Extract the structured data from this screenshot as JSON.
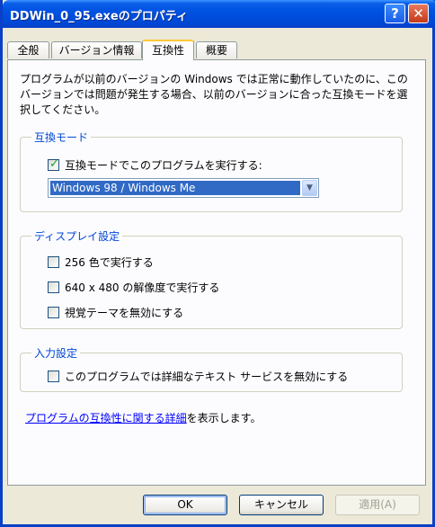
{
  "window": {
    "title": "DDWin_0_95.exeのプロパティ",
    "help_label": "?",
    "close_label": "✕"
  },
  "tabs": [
    {
      "label": "全般",
      "active": false
    },
    {
      "label": "バージョン情報",
      "active": false
    },
    {
      "label": "互換性",
      "active": true
    },
    {
      "label": "概要",
      "active": false
    }
  ],
  "description": "プログラムが以前のバージョンの Windows では正常に動作していたのに、このバージョンでは問題が発生する場合、以前のバージョンに合った互換モードを選択してください。",
  "compat_mode": {
    "legend": "互換モード",
    "checkbox_label": "互換モードでこのプログラムを実行する:",
    "checked": true,
    "selected_os": "Windows 98 / Windows Me"
  },
  "display_settings": {
    "legend": "ディスプレイ設定",
    "options": [
      {
        "label": "256 色で実行する",
        "checked": false
      },
      {
        "label": "640 x 480 の解像度で実行する",
        "checked": false
      },
      {
        "label": "視覚テーマを無効にする",
        "checked": false
      }
    ]
  },
  "input_settings": {
    "legend": "入力設定",
    "options": [
      {
        "label": "このプログラムでは詳細なテキスト サービスを無効にする",
        "checked": false
      }
    ]
  },
  "link": {
    "text": "プログラムの互換性に関する詳細",
    "suffix": "を表示します。"
  },
  "buttons": {
    "ok": "OK",
    "cancel": "キャンセル",
    "apply": "適用(A)"
  },
  "colors": {
    "titlebar": "#0052e2",
    "legend": "#0046d5",
    "link": "#0000ff",
    "selection": "#316ac5",
    "background": "#ece9d8"
  }
}
